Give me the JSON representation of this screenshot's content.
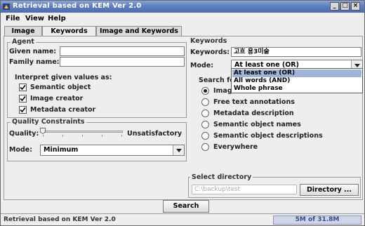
{
  "window": {
    "title": "Retrieval based on KEM Ver 2.0",
    "controls": {
      "minimize": "_",
      "maximize": "□",
      "close": "×"
    }
  },
  "menu": {
    "file": "File",
    "view": "View",
    "help": "Help"
  },
  "tabs": [
    {
      "label": "Image",
      "active": false
    },
    {
      "label": "Keywords",
      "active": true
    },
    {
      "label": "Image and Keywords",
      "active": false
    }
  ],
  "agent": {
    "title": "Agent",
    "given_name_label": "Given name:",
    "given_name_value": "",
    "family_name_label": "Family name:",
    "family_name_value": "",
    "interpret_label": "Interpret given values as:",
    "options": [
      {
        "label": "Semantic object",
        "checked": true
      },
      {
        "label": "Image creator",
        "checked": true
      },
      {
        "label": "Metadata creator",
        "checked": true
      }
    ]
  },
  "quality": {
    "title": "Quality Constraints",
    "quality_label": "Quality:",
    "quality_value_label": "Unsatisfactory",
    "slider_level": 0.0,
    "mode_label": "Mode:",
    "mode_value": "Minimum"
  },
  "keywords": {
    "title": "Keywords",
    "keywords_label": "Keywords:",
    "keywords_value": "고흐 용3미술",
    "mode_label": "Mode:",
    "mode_value": "At least one (OR)",
    "dropdown_options": [
      "At least one (OR)",
      "All words (AND)",
      "Whole phrase"
    ],
    "search_for_label": "Search fo",
    "search_options": [
      {
        "label": "Image",
        "selected": true
      },
      {
        "label": "Free text annotations",
        "selected": false
      },
      {
        "label": "Metadata description",
        "selected": false
      },
      {
        "label": "Semantic object names",
        "selected": false
      },
      {
        "label": "Semantic object descriptions",
        "selected": false
      },
      {
        "label": "Everywhere",
        "selected": false
      }
    ]
  },
  "directory": {
    "title": "Select directory",
    "path": "C:\\backup\\test",
    "button": "Directory ..."
  },
  "search_button": "Search",
  "status": {
    "text": "Retrieval based on KEM Ver 2.0",
    "memory": "5M of 31.8M"
  },
  "colors": {
    "titlebar": "#5f7fc0",
    "selection": "#9fb4d8",
    "memory_fill": "#cfd6ea"
  }
}
